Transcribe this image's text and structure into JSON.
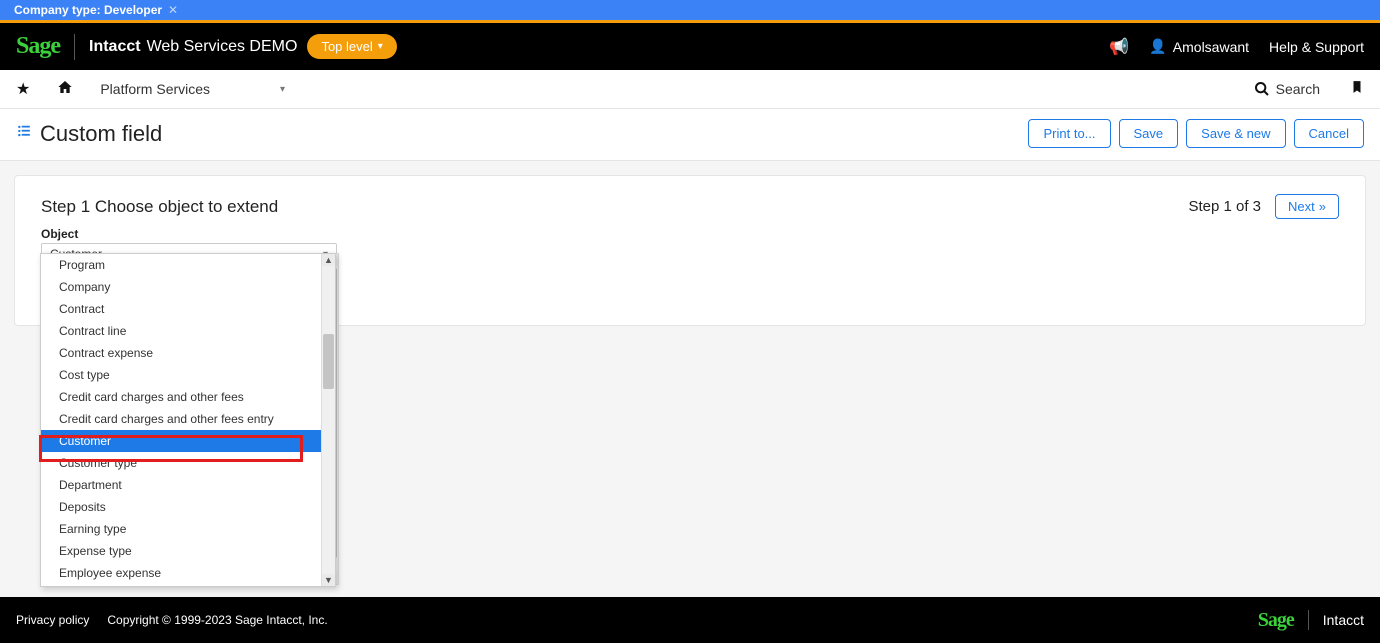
{
  "banner": {
    "company_type_label": "Company type: Developer"
  },
  "header": {
    "logo": "Sage",
    "product": "Intacct",
    "env": "Web Services DEMO",
    "top_level": "Top level",
    "username": "Amolsawant",
    "help": "Help & Support"
  },
  "nav": {
    "module": "Platform Services",
    "search": "Search"
  },
  "page": {
    "title": "Custom field",
    "buttons": {
      "print": "Print to...",
      "save": "Save",
      "save_new": "Save & new",
      "cancel": "Cancel"
    }
  },
  "step": {
    "title": "Step 1 Choose object to extend",
    "counter": "Step 1 of 3",
    "next": "Next",
    "field_label": "Object",
    "selected": "Customer"
  },
  "options": [
    "Program",
    "Company",
    "Contract",
    "Contract line",
    "Contract expense",
    "Cost type",
    "Credit card charges and other fees",
    "Credit card charges and other fees entry",
    "Customer",
    "Customer type",
    "Department",
    "Deposits",
    "Earning type",
    "Expense type",
    "Employee expense"
  ],
  "footer": {
    "privacy": "Privacy policy",
    "copyright": "Copyright © 1999-2023 Sage Intacct, Inc.",
    "logo": "Sage",
    "product": "Intacct"
  }
}
